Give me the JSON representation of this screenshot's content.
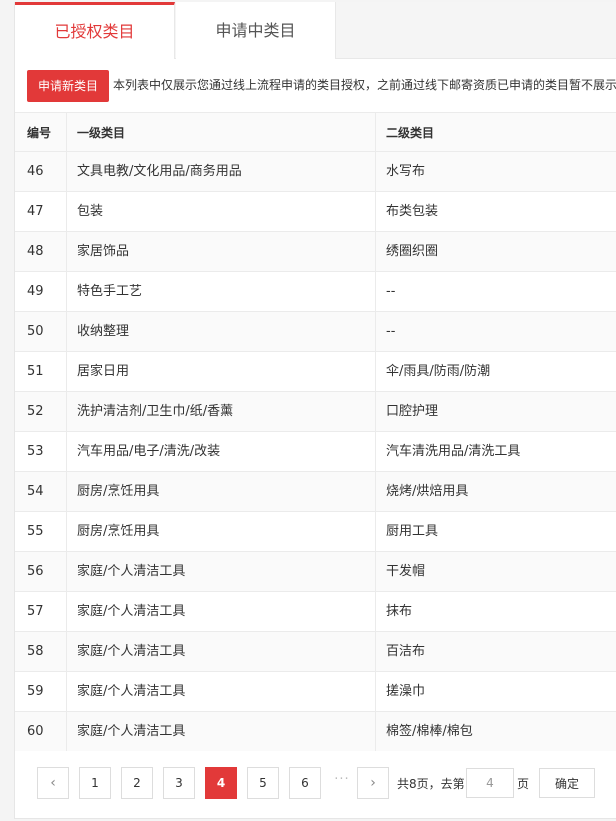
{
  "tabs": [
    {
      "label": "已授权类目",
      "active": true
    },
    {
      "label": "申请中类目",
      "active": false
    }
  ],
  "notice": {
    "apply_button": "申请新类目",
    "text": "本列表中仅展示您通过线上流程申请的类目授权，之前通过线下邮寄资质已申请的类目暂不展示"
  },
  "table": {
    "headers": [
      "编号",
      "一级类目",
      "二级类目"
    ],
    "rows": [
      [
        "46",
        "文具电教/文化用品/商务用品",
        "水写布"
      ],
      [
        "47",
        "包装",
        "布类包装"
      ],
      [
        "48",
        "家居饰品",
        "绣圈织圈"
      ],
      [
        "49",
        "特色手工艺",
        "--"
      ],
      [
        "50",
        "收纳整理",
        "--"
      ],
      [
        "51",
        "居家日用",
        "伞/雨具/防雨/防潮"
      ],
      [
        "52",
        "洗护清洁剂/卫生巾/纸/香薰",
        "口腔护理"
      ],
      [
        "53",
        "汽车用品/电子/清洗/改装",
        "汽车清洗用品/清洗工具"
      ],
      [
        "54",
        "厨房/烹饪用具",
        "烧烤/烘焙用具"
      ],
      [
        "55",
        "厨房/烹饪用具",
        "厨用工具"
      ],
      [
        "56",
        "家庭/个人清洁工具",
        "干发帽"
      ],
      [
        "57",
        "家庭/个人清洁工具",
        "抹布"
      ],
      [
        "58",
        "家庭/个人清洁工具",
        "百洁布"
      ],
      [
        "59",
        "家庭/个人清洁工具",
        "搓澡巾"
      ],
      [
        "60",
        "家庭/个人清洁工具",
        "棉签/棉棒/棉包"
      ]
    ]
  },
  "pagination": {
    "prev": "‹",
    "next": "›",
    "pages": [
      "1",
      "2",
      "3",
      "4",
      "5",
      "6"
    ],
    "current": "4",
    "ellipsis": "···",
    "total_text": "共8页，去第",
    "goto_value": "4",
    "page_suffix": "页",
    "confirm": "确定"
  }
}
